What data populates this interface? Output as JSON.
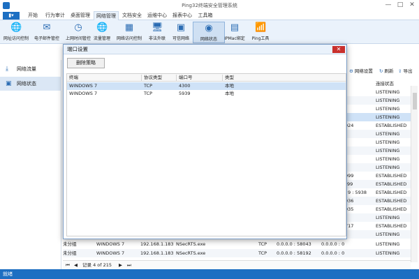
{
  "window": {
    "title": "Ping32终端安全管理系统",
    "minimize": "—",
    "maximize": "□",
    "close": "✕",
    "menu_button": "▮▾"
  },
  "tabs": [
    {
      "label": "开始"
    },
    {
      "label": "行为审计"
    },
    {
      "label": "桌面管理"
    },
    {
      "label": "网络管理"
    },
    {
      "label": "文档安全"
    },
    {
      "label": "运维中心"
    },
    {
      "label": "报表中心"
    },
    {
      "label": "工具箱"
    }
  ],
  "active_tab": "网络管理",
  "ribbon": [
    {
      "label": "网址访问控制",
      "icon": "globe-icon",
      "glyph": "🌐"
    },
    {
      "label": "电子邮件管控",
      "icon": "email-icon",
      "glyph": "✉"
    },
    {
      "label": "上网时间管控",
      "icon": "clock-icon",
      "glyph": "◷"
    },
    {
      "label": "流量管理",
      "icon": "globe-flow-icon",
      "glyph": "🌐"
    },
    {
      "label": "网络访问控制",
      "icon": "firewall-icon",
      "glyph": "▦"
    },
    {
      "label": "非法外联",
      "icon": "computer-icon",
      "glyph": "🖥"
    },
    {
      "label": "可信网络",
      "icon": "trusted-network-icon",
      "glyph": "▣"
    },
    {
      "label": "网络状态",
      "icon": "network-status-icon",
      "glyph": "◉"
    },
    {
      "label": "IPMac绑定",
      "icon": "ipmac-icon",
      "glyph": "▤"
    },
    {
      "label": "Ping工具",
      "icon": "ping-icon",
      "glyph": "📶"
    }
  ],
  "leftnav": [
    {
      "label": "网络流量",
      "icon": "traffic-icon",
      "glyph": "⤓"
    },
    {
      "label": "网络状态",
      "icon": "network-icon",
      "glyph": "▣"
    }
  ],
  "right_tools": {
    "network_settings": "网络设置",
    "refresh": "刷新",
    "export": "导出"
  },
  "bg_header": {
    "conn_state": "连接状态"
  },
  "bg_rows": [
    {
      "remote": "",
      "state": "LISTENING"
    },
    {
      "remote": "",
      "state": "LISTENING"
    },
    {
      "remote": "",
      "state": "LISTENING"
    },
    {
      "remote": "",
      "state": "LISTENING"
    },
    {
      "remote": "924",
      "state": "ESTABLISHED"
    },
    {
      "remote": "",
      "state": "LISTENING"
    },
    {
      "remote": "",
      "state": "LISTENING"
    },
    {
      "remote": "",
      "state": "LISTENING"
    },
    {
      "remote": "",
      "state": "LISTENING"
    },
    {
      "remote": "",
      "state": "LISTENING"
    },
    {
      "remote": "999",
      "state": "ESTABLISHED"
    },
    {
      "remote": "99",
      "state": "ESTABLISHED"
    },
    {
      "remote": "9 : 5938",
      "state": "ESTABLISHED"
    },
    {
      "remote": "936",
      "state": "ESTABLISHED"
    },
    {
      "remote": "935",
      "state": "ESTABLISHED"
    },
    {
      "remote": "",
      "state": "LISTENING"
    },
    {
      "remote": "717",
      "state": "ESTABLISHED"
    },
    {
      "remote": "",
      "state": "LISTENING"
    }
  ],
  "bg_bottom_rows": [
    {
      "group": "未分组",
      "os": "WINDOWS 7",
      "ip": "192.168.1.183",
      "proc": "NSecRTS.exe",
      "proto": "TCP",
      "local": "0.0.0.0 : 58043",
      "remote": "0.0.0.0 : 0",
      "state": "LISTENING"
    },
    {
      "group": "未分组",
      "os": "WINDOWS 7",
      "ip": "192.168.1.183",
      "proc": "NSecRTS.exe",
      "proto": "TCP",
      "local": "0.0.0.0 : 58192",
      "remote": "0.0.0.0 : 0",
      "state": "LISTENING"
    }
  ],
  "pager": {
    "first": "⏮",
    "prev": "◀",
    "text": "记录 4 of 215",
    "next": "▶",
    "last": "⏭"
  },
  "status": "就绪",
  "dialog": {
    "title": "端口设置",
    "close": "✕",
    "delete_button": "删除策略",
    "columns": [
      "终端",
      "协议类型",
      "端口号",
      "类型"
    ],
    "rows": [
      {
        "terminal": "WINDOWS 7",
        "protocol": "TCP",
        "port": "4300",
        "type": "本地"
      },
      {
        "terminal": "WINDOWS 7",
        "protocol": "TCP",
        "port": "5939",
        "type": "本地"
      }
    ]
  }
}
